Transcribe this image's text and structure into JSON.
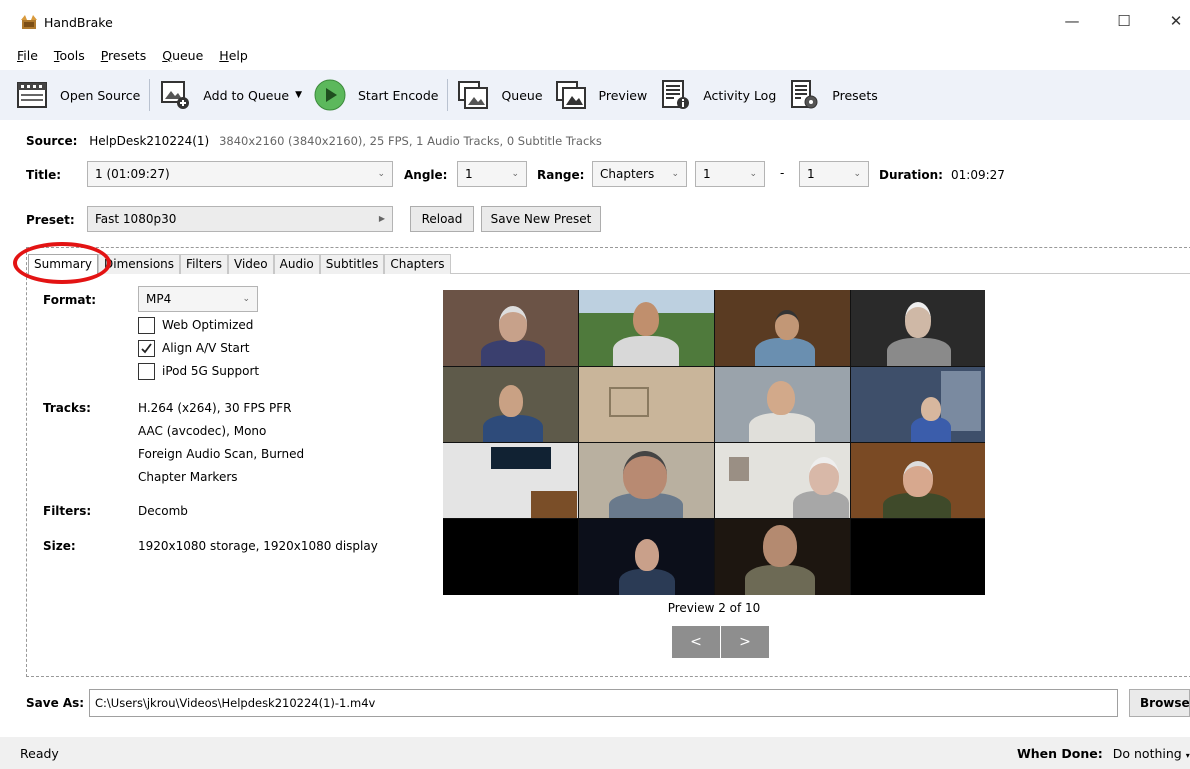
{
  "window": {
    "title": "HandBrake",
    "minimize": "—",
    "maximize": "☐",
    "close": "✕"
  },
  "menu": [
    {
      "ul": "F",
      "rest": "ile"
    },
    {
      "ul": "T",
      "rest": "ools"
    },
    {
      "ul": "P",
      "rest": "resets"
    },
    {
      "ul": "Q",
      "rest": "ueue"
    },
    {
      "ul": "H",
      "rest": "elp"
    }
  ],
  "toolbar": {
    "open_source": "Open Source",
    "add_to_queue": "Add to Queue",
    "start_encode": "Start Encode",
    "queue": "Queue",
    "preview": "Preview",
    "activity_log": "Activity Log",
    "presets": "Presets"
  },
  "source": {
    "label": "Source:",
    "name": "HelpDesk210224(1)",
    "details": "3840x2160 (3840x2160), 25 FPS, 1 Audio Tracks, 0 Subtitle Tracks"
  },
  "title_row": {
    "title_label": "Title:",
    "title_value": "1 (01:09:27)",
    "angle_label": "Angle:",
    "angle_value": "1",
    "range_label": "Range:",
    "range_value": "Chapters",
    "range_start": "1",
    "range_dash": "-",
    "range_end": "1",
    "duration_label": "Duration:",
    "duration_value": "01:09:27"
  },
  "preset_row": {
    "label": "Preset:",
    "value": "Fast 1080p30",
    "reload": "Reload",
    "save_new": "Save New Preset"
  },
  "tabs": [
    "Summary",
    "Dimensions",
    "Filters",
    "Video",
    "Audio",
    "Subtitles",
    "Chapters"
  ],
  "summary": {
    "format_label": "Format:",
    "format_value": "MP4",
    "web_optimized": "Web Optimized",
    "web_optimized_checked": false,
    "align_av": "Align A/V Start",
    "align_av_checked": true,
    "ipod": "iPod 5G Support",
    "ipod_checked": false,
    "tracks_label": "Tracks:",
    "tracks": [
      "H.264 (x264), 30 FPS PFR",
      "AAC (avcodec), Mono",
      "Foreign Audio Scan, Burned",
      "Chapter Markers"
    ],
    "filters_label": "Filters:",
    "filters_value": "Decomb",
    "size_label": "Size:",
    "size_value": "1920x1080 storage, 1920x1080 display"
  },
  "preview": {
    "caption": "Preview 2 of 10",
    "prev": "<",
    "next": ">"
  },
  "save_as": {
    "label": "Save As:",
    "path": "C:\\Users\\jkrou\\Videos\\Helpdesk210224(1)-1.m4v",
    "browse": "Browse"
  },
  "status": {
    "left": "Ready",
    "when_done_label": "When Done:",
    "when_done_value": "Do nothing"
  }
}
